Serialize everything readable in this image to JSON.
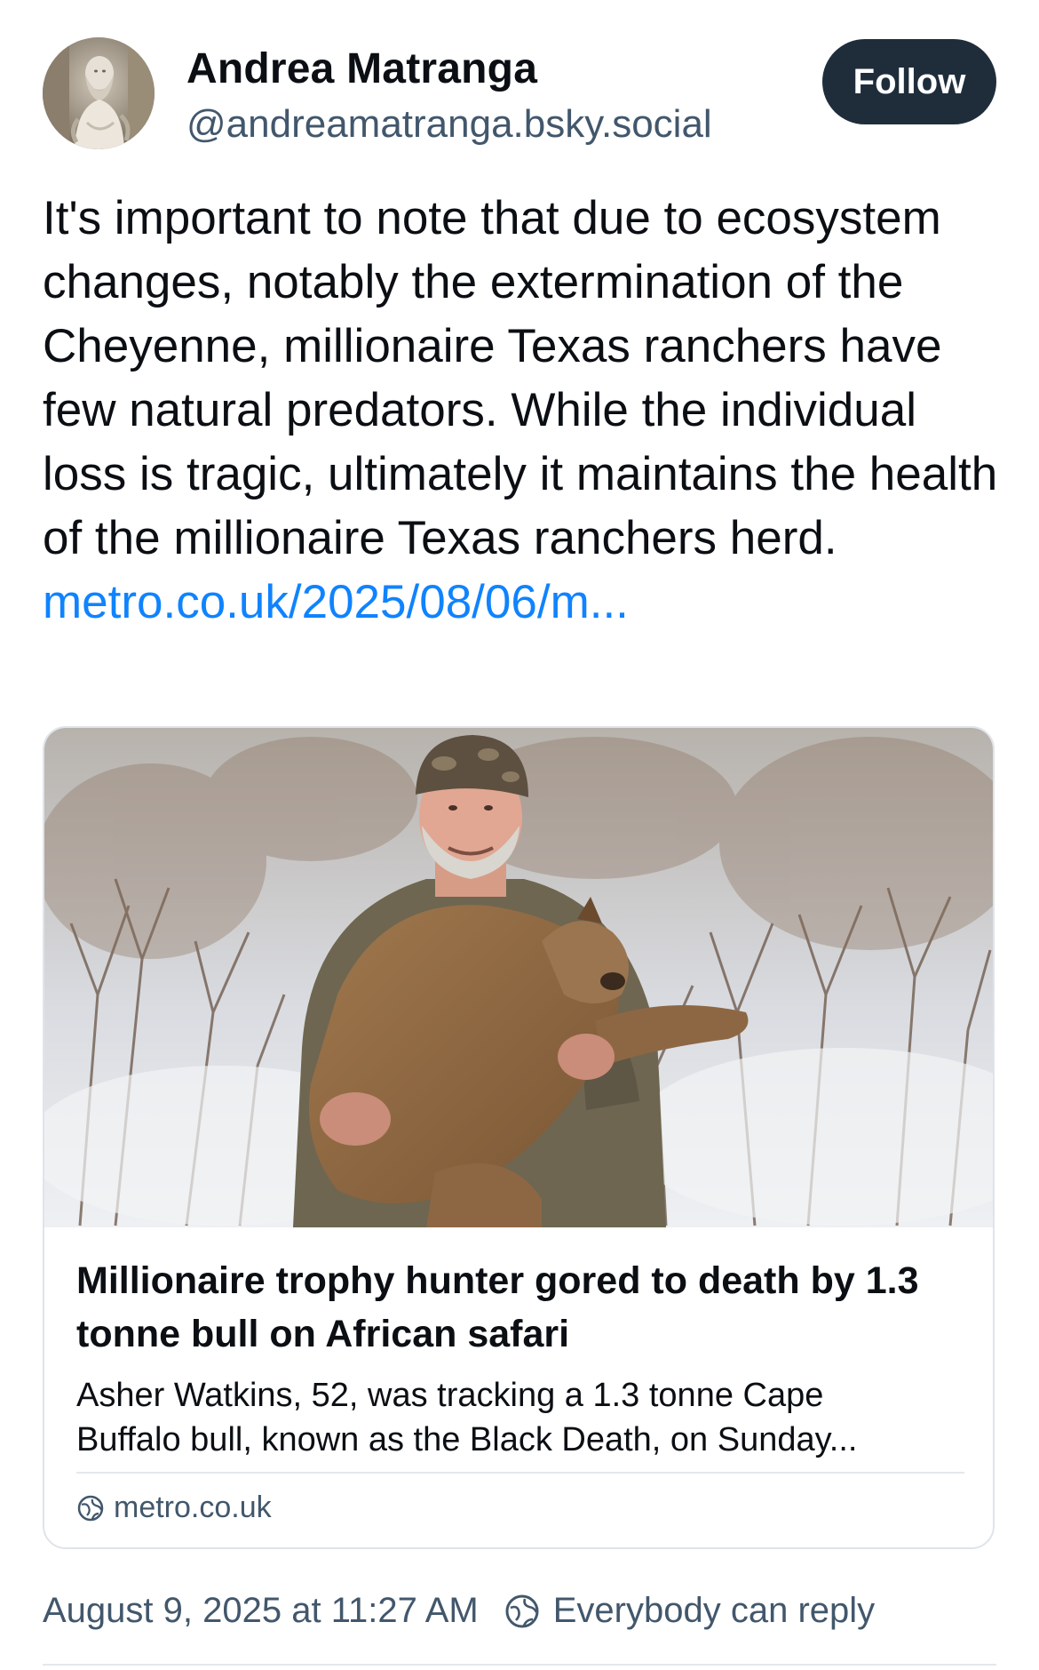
{
  "author": {
    "display_name": "Andrea Matranga",
    "handle": "@andreamatranga.bsky.social",
    "avatar_icon": "statue-avatar"
  },
  "follow_button": {
    "label": "Follow",
    "color": "#1f2d3b"
  },
  "post": {
    "text": "It's important to note that due to ecosystem changes, notably the extermination of the Cheyenne, millionaire Texas ranchers have few natural predators. While the individual loss is tragic, ultimately it maintains the health of the millionaire Texas ranchers herd. ",
    "link_text": "metro.co.uk/2025/08/06/m...",
    "link_color": "#1083fe"
  },
  "embed": {
    "image_icon": "hunter-with-mountain-lion-photo",
    "title": "Millionaire trophy hunter gored to death by 1.3 tonne bull on African safari",
    "description_line1": "Asher Watkins, 52, was tracking a 1.3 tonne Cape",
    "description_line2": "Buffalo bull, known as the Black Death, on Sunday...",
    "domain": "metro.co.uk",
    "domain_icon": "globe-icon"
  },
  "meta": {
    "timestamp": "August 9, 2025 at 11:27 AM",
    "reply_setting": "Everybody can reply",
    "reply_icon": "everybody-reply-icon"
  }
}
